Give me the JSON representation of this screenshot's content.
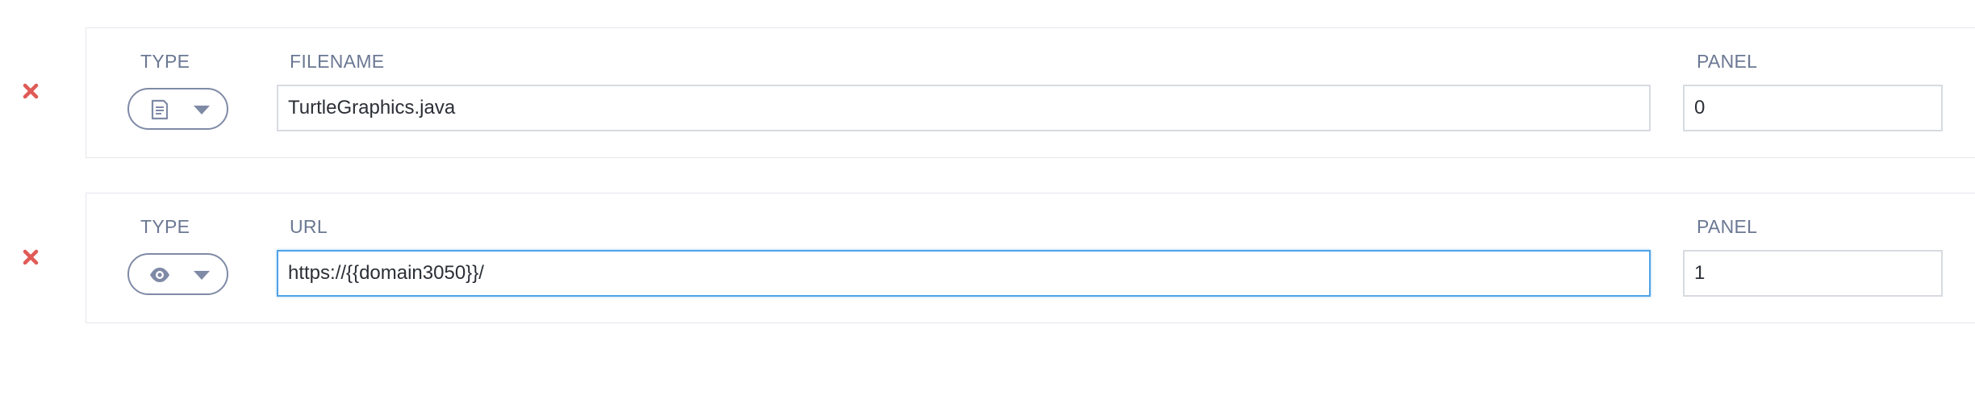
{
  "rows": [
    {
      "remove_icon": "close-icon",
      "type_label": "TYPE",
      "type_icon": "document-icon",
      "main_label": "FILENAME",
      "main_value": "TurtleGraphics.java",
      "panel_label": "PANEL",
      "panel_value": "0",
      "focused": false
    },
    {
      "remove_icon": "close-icon",
      "type_label": "TYPE",
      "type_icon": "eye-icon",
      "main_label": "URL",
      "main_value": "https://{{domain3050}}/",
      "panel_label": "PANEL",
      "panel_value": "1",
      "focused": true
    }
  ],
  "colors": {
    "remove": "#e05a56",
    "label": "#6b7893",
    "select_border": "#7f8aa6",
    "focus": "#4fa3e8",
    "input_border": "#d7dbe1",
    "card_border": "#e4e7ec"
  }
}
